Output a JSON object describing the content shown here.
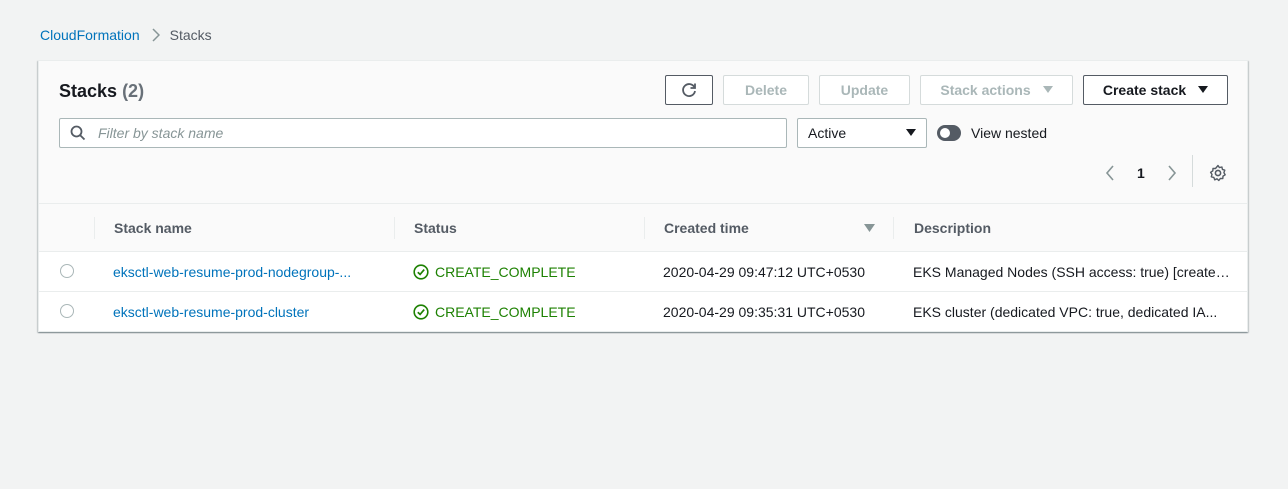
{
  "breadcrumb": {
    "parent": "CloudFormation",
    "current": "Stacks"
  },
  "header": {
    "title": "Stacks",
    "count": "(2)"
  },
  "toolbar": {
    "delete_label": "Delete",
    "update_label": "Update",
    "stack_actions_label": "Stack actions",
    "create_stack_label": "Create stack"
  },
  "filter": {
    "placeholder": "Filter by stack name",
    "status_selected": "Active",
    "view_nested_label": "View nested"
  },
  "pagination": {
    "current_page": "1"
  },
  "table": {
    "columns": [
      "Stack name",
      "Status",
      "Created time",
      "Description"
    ],
    "rows": [
      {
        "name": "eksctl-web-resume-prod-nodegroup-...",
        "status": "CREATE_COMPLETE",
        "created": "2020-04-29 09:47:12 UTC+0530",
        "description": "EKS Managed Nodes (SSH access: true) [created..."
      },
      {
        "name": "eksctl-web-resume-prod-cluster",
        "status": "CREATE_COMPLETE",
        "created": "2020-04-29 09:35:31 UTC+0530",
        "description": "EKS cluster (dedicated VPC: true, dedicated IA..."
      }
    ]
  },
  "icons": {
    "refresh": "refresh-icon",
    "search": "search-icon",
    "settings": "gear-icon",
    "status_ok": "check-circle-icon"
  },
  "colors": {
    "link": "#0073bb",
    "success": "#1d8102",
    "background": "#f2f3f3"
  }
}
